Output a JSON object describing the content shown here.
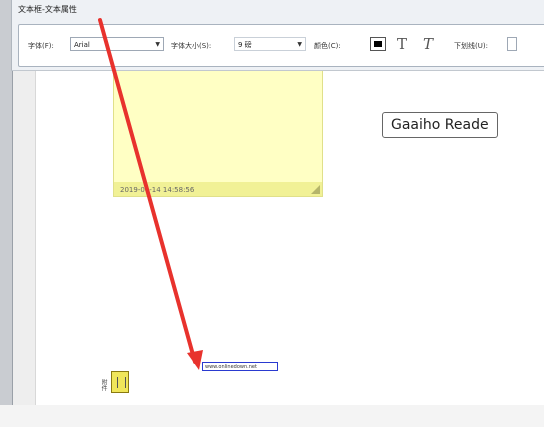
{
  "toolbar": {
    "title": "文本框-文本属性",
    "font_label": "字体(F):",
    "font_value": "Arial",
    "size_label": "字体大小(S):",
    "size_value": "9 磅",
    "color_label": "颜色(C):",
    "bold_glyph": "T",
    "italic_glyph": "T",
    "underline_label": "下划线(U):",
    "dropdown_glyph": "▼",
    "colors": {
      "text_color": "#000000"
    }
  },
  "note": {
    "timestamp": "2019-06-14 14:58:56"
  },
  "textbox": {
    "text": "Gaaiho Reade"
  },
  "link": {
    "text": "www.onlinedown.net"
  },
  "attachment": {
    "label": "附件"
  },
  "annotation": {
    "arrow_color": "#e8322d"
  }
}
